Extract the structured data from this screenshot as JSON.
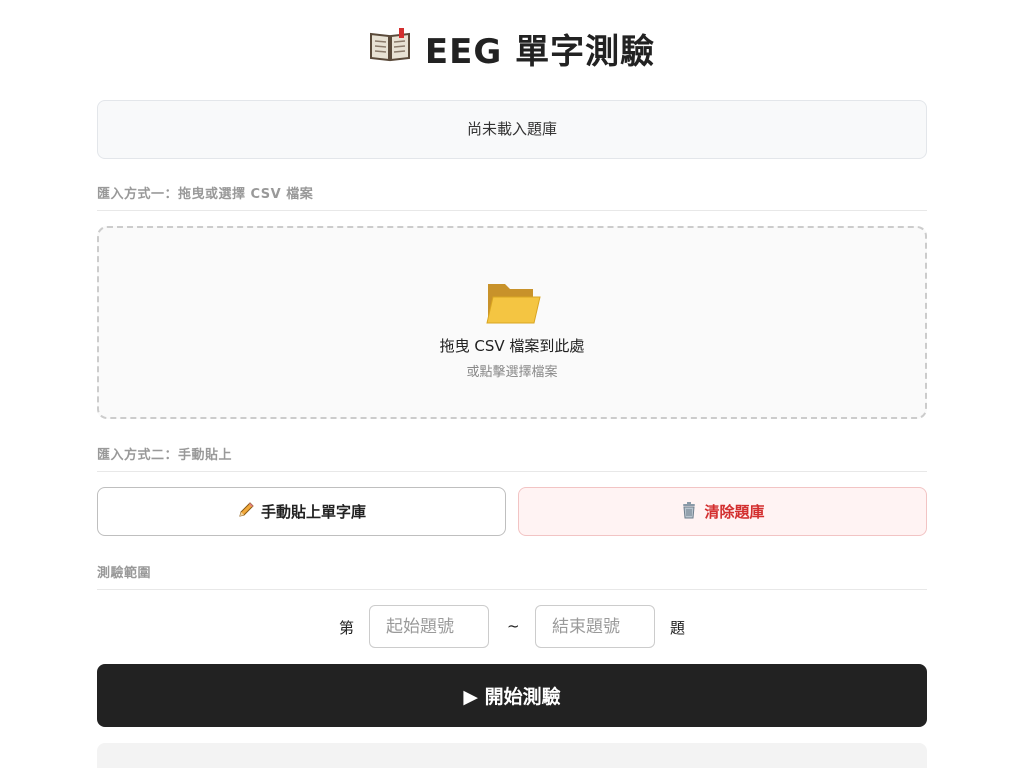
{
  "header": {
    "title": "EEG 單字測驗",
    "icon": "open-book-icon"
  },
  "status": {
    "text": "尚未載入題庫"
  },
  "import_csv": {
    "section_label": "匯入方式一：拖曳或選擇 CSV 檔案",
    "drop_icon": "folder-icon",
    "drop_main": "拖曳 CSV 檔案到此處",
    "drop_sub": "或點擊選擇檔案"
  },
  "import_manual": {
    "section_label": "匯入方式二：手動貼上",
    "paste_label": "手動貼上單字庫",
    "paste_icon": "pencil-icon",
    "clear_label": "清除題庫",
    "clear_icon": "trash-icon"
  },
  "range": {
    "section_label": "測驗範圍",
    "prefix": "第",
    "start_placeholder": "起始題號",
    "separator": "~",
    "end_placeholder": "結束題號",
    "suffix": "題"
  },
  "start": {
    "label": "▶ 開始測驗"
  },
  "colors": {
    "primary": "#222222",
    "danger": "#d32f2f",
    "danger_bg": "#fff3f3"
  }
}
